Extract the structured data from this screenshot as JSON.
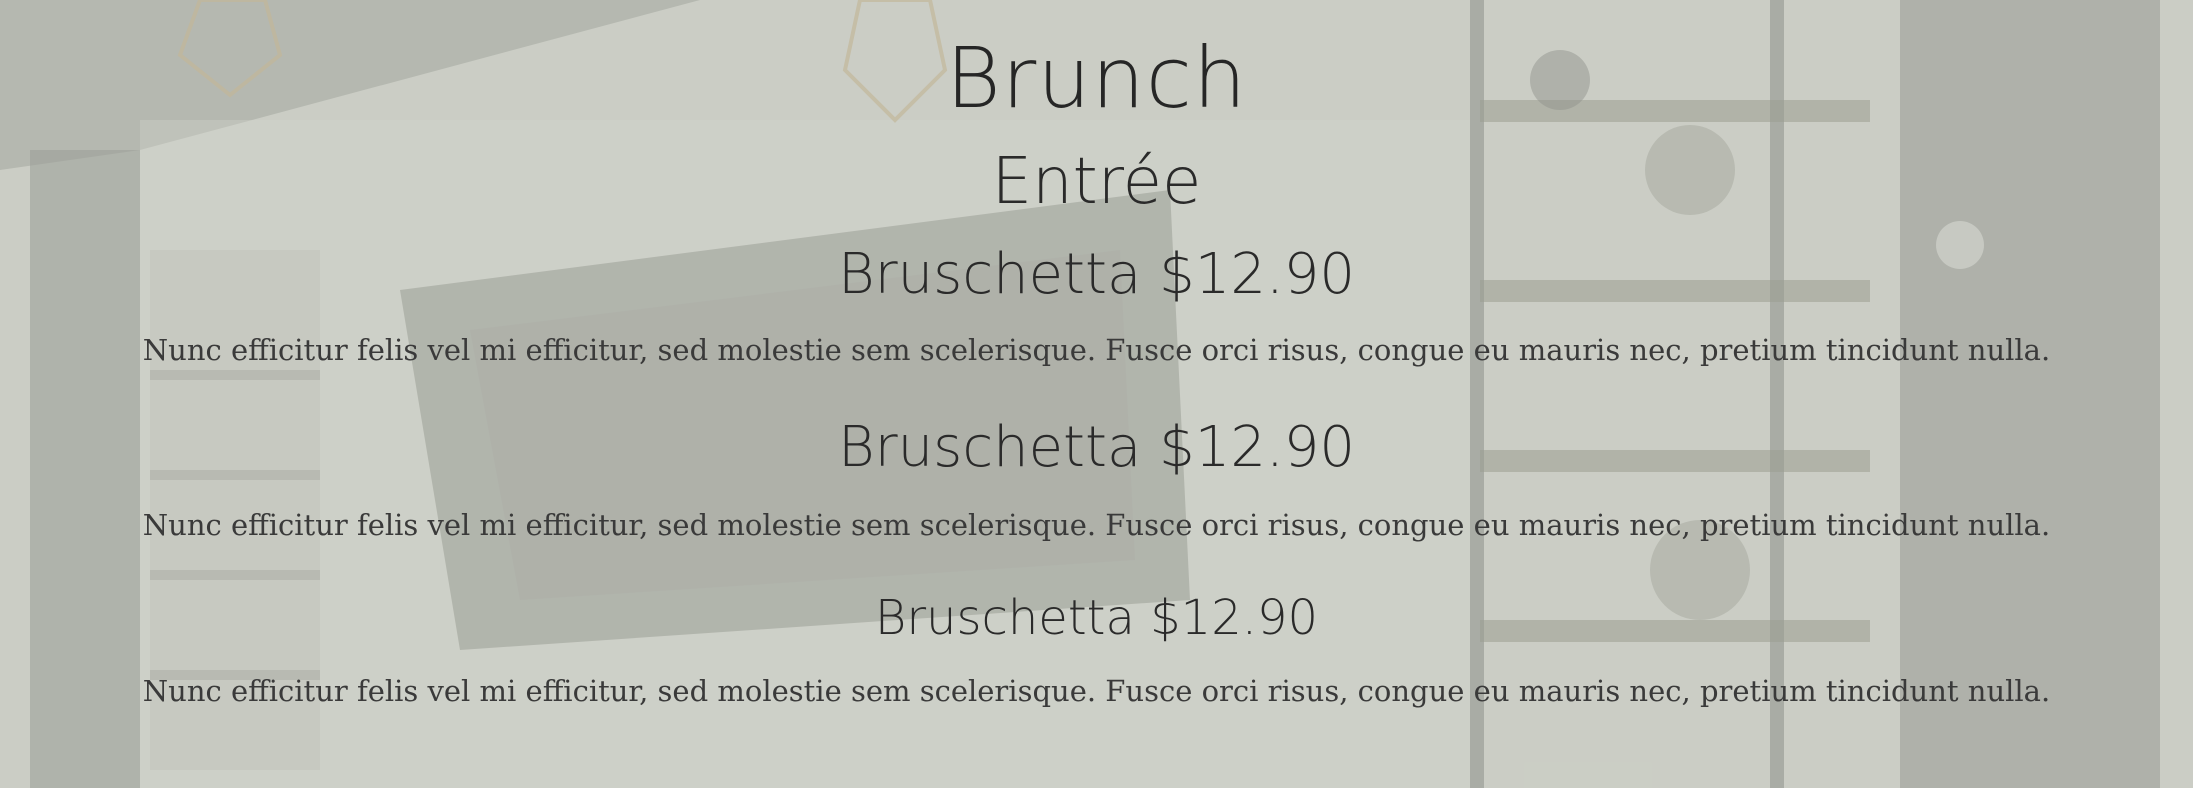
{
  "menu": {
    "title": "Brunch",
    "section": "Entrée",
    "items": [
      {
        "name": "Bruschetta $12.90",
        "description": "Nunc efficitur felis vel mi efficitur, sed molestie sem scelerisque. Fusce orci risus, congue eu mauris nec, pretium tincidunt nulla."
      },
      {
        "name": "Bruschetta $12.90",
        "description": "Nunc efficitur felis vel mi efficitur, sed molestie sem scelerisque. Fusce orci risus, congue eu mauris nec, pretium tincidunt nulla."
      },
      {
        "name": "Bruschetta $12.90",
        "description": "Nunc efficitur felis vel mi efficitur, sed molestie sem scelerisque. Fusce orci risus, congue eu mauris nec, pretium tincidunt nulla."
      }
    ]
  },
  "colors": {
    "text": "#2b2b2b",
    "background_tint": "#c8cbc2"
  }
}
